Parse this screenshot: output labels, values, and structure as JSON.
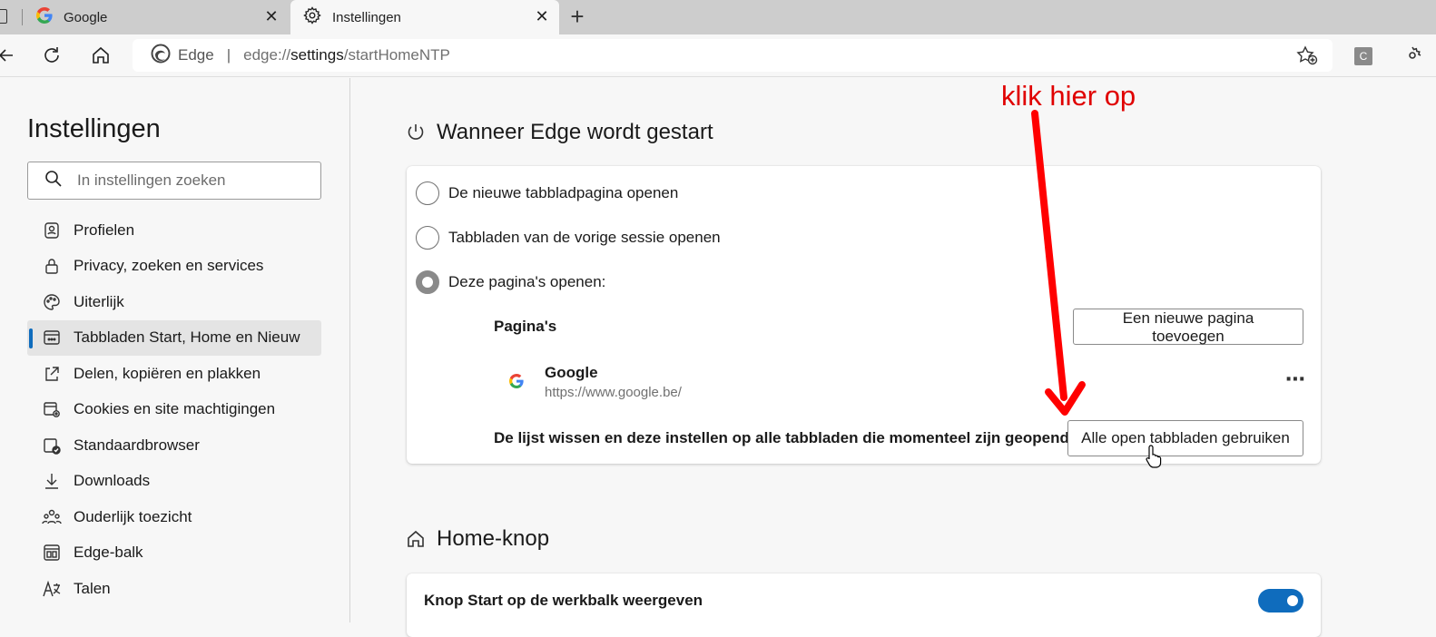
{
  "tabs": [
    {
      "title": "Google",
      "icon": "google-g-icon",
      "active": false
    },
    {
      "title": "Instellingen",
      "icon": "gear-icon",
      "active": true
    }
  ],
  "toolbar": {
    "address_brand": "Edge",
    "url_scheme": "edge://",
    "url_host": "settings",
    "url_path": "/startHomeNTP",
    "profile_letter": "C"
  },
  "sidebar": {
    "title": "Instellingen",
    "search_placeholder": "In instellingen zoeken",
    "items": [
      {
        "label": "Profielen",
        "icon": "profile-icon"
      },
      {
        "label": "Privacy, zoeken en services",
        "icon": "lock-icon"
      },
      {
        "label": "Uiterlijk",
        "icon": "palette-icon"
      },
      {
        "label": "Tabbladen Start, Home en Nieuw",
        "icon": "newtab-icon",
        "active": true
      },
      {
        "label": "Delen, kopiëren en plakken",
        "icon": "share-icon"
      },
      {
        "label": "Cookies en site machtigingen",
        "icon": "cookie-icon"
      },
      {
        "label": "Standaardbrowser",
        "icon": "browser-check-icon"
      },
      {
        "label": "Downloads",
        "icon": "download-icon"
      },
      {
        "label": "Ouderlijk toezicht",
        "icon": "family-icon"
      },
      {
        "label": "Edge-balk",
        "icon": "sidebar-panel-icon"
      },
      {
        "label": "Talen",
        "icon": "language-icon"
      }
    ]
  },
  "startup": {
    "title": "Wanneer Edge wordt gestart",
    "options": [
      {
        "label": "De nieuwe tabbladpagina openen",
        "checked": false
      },
      {
        "label": "Tabbladen van de vorige sessie openen",
        "checked": false
      },
      {
        "label": "Deze pagina's openen:",
        "checked": true
      }
    ],
    "pages_label": "Pagina's",
    "add_page_button": "Een nieuwe pagina toevoegen",
    "pages": [
      {
        "name": "Google",
        "url": "https://www.google.be/"
      }
    ],
    "clear_label": "De lijst wissen en deze instellen op alle tabbladen die momenteel zijn geopend",
    "use_all_button": "Alle open tabbladen gebruiken"
  },
  "home": {
    "title": "Home-knop",
    "toggle_label": "Knop Start op de werkbalk weergeven",
    "toggle_on": true
  },
  "annotation": {
    "text": "klik hier op",
    "color": "#e00000"
  },
  "colors": {
    "accent": "#0f6cbd"
  }
}
